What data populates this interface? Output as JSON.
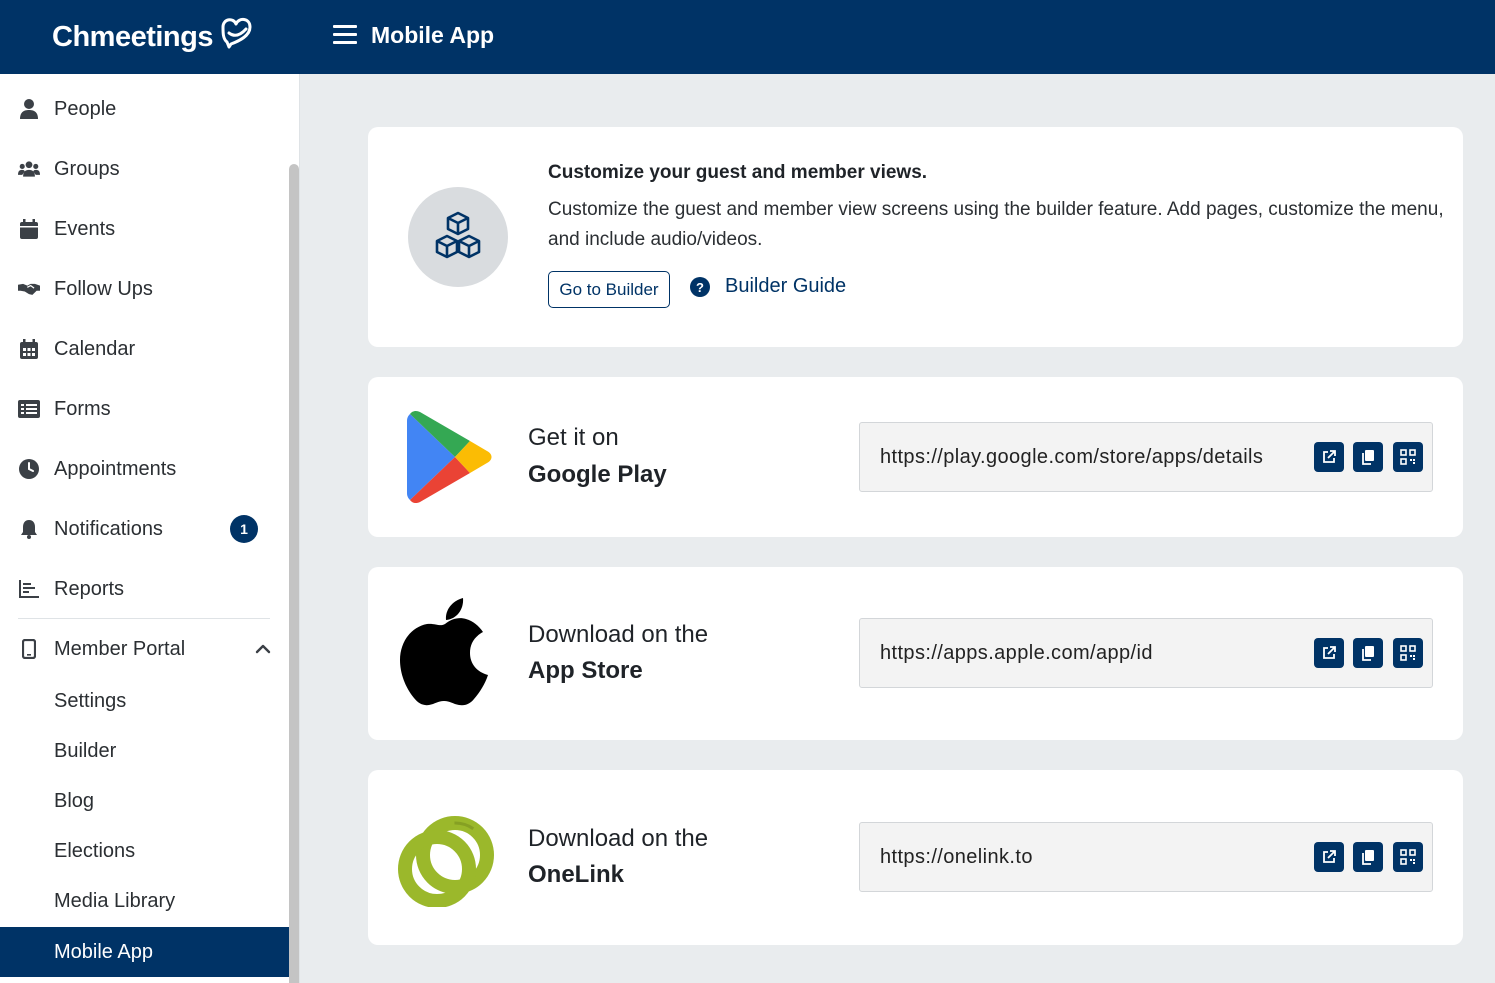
{
  "header": {
    "logo_text": "Chmeetings",
    "page_title": "Mobile App"
  },
  "sidebar": {
    "items": [
      {
        "label": "People",
        "icon": "person-icon"
      },
      {
        "label": "Groups",
        "icon": "users-icon"
      },
      {
        "label": "Events",
        "icon": "calendar-icon"
      },
      {
        "label": "Follow Ups",
        "icon": "handshake-icon"
      },
      {
        "label": "Calendar",
        "icon": "calendar-grid-icon"
      },
      {
        "label": "Forms",
        "icon": "list-icon"
      },
      {
        "label": "Appointments",
        "icon": "clock-icon"
      },
      {
        "label": "Notifications",
        "icon": "bell-icon",
        "badge": "1"
      },
      {
        "label": "Reports",
        "icon": "bar-chart-icon"
      },
      {
        "label": "Member Portal",
        "icon": "mobile-icon",
        "expanded": true
      }
    ],
    "subitems": [
      {
        "label": "Settings"
      },
      {
        "label": "Builder"
      },
      {
        "label": "Blog"
      },
      {
        "label": "Elections"
      },
      {
        "label": "Media Library"
      },
      {
        "label": "Mobile App",
        "active": true
      }
    ]
  },
  "builder_card": {
    "title": "Customize your guest and member views.",
    "description": "Customize the guest and member view screens using the builder feature. Add pages, customize the menu, and include audio/videos.",
    "button_label": "Go to Builder",
    "guide_icon": "?",
    "guide_label": "Builder Guide"
  },
  "stores": [
    {
      "line1": "Get it on",
      "line2": "Google Play",
      "url": "https://play.google.com/store/apps/details",
      "icon": "google-play-icon"
    },
    {
      "line1": "Download on the",
      "line2": "App Store",
      "url": "https://apps.apple.com/app/id",
      "icon": "apple-icon"
    },
    {
      "line1": "Download on the",
      "line2": "OneLink",
      "url": "https://onelink.to",
      "icon": "onelink-icon"
    }
  ],
  "colors": {
    "primary": "#003366",
    "background": "#e9ecee",
    "onelink_green": "#9bb82b"
  }
}
